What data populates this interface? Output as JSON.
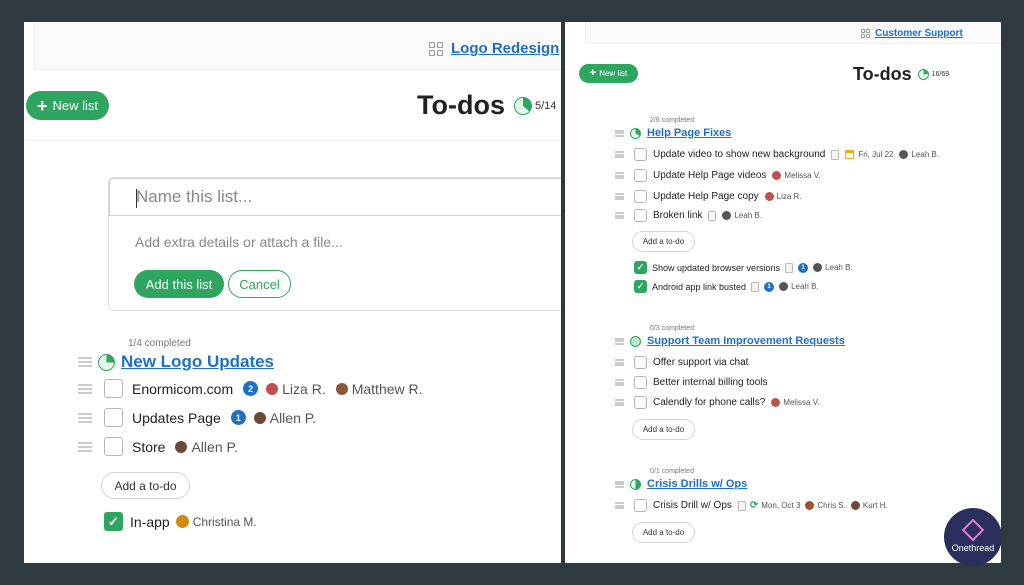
{
  "left": {
    "project_link": "Logo Redesign",
    "new_list_label": "New list",
    "title": "To-dos",
    "count": "5/14",
    "form": {
      "name_placeholder": "Name this list...",
      "details_placeholder": "Add extra details or attach a file...",
      "add_label": "Add this list",
      "cancel_label": "Cancel"
    },
    "list": {
      "meta": "1/4 completed",
      "title": "New Logo Updates",
      "todos": [
        {
          "text": "Enormicom.com",
          "badge": "2",
          "people": [
            "Liza R.",
            "Matthew R."
          ]
        },
        {
          "text": "Updates Page",
          "badge": "1",
          "people": [
            "Allen P."
          ]
        },
        {
          "text": "Store",
          "badge": "",
          "people": [
            "Allen P."
          ]
        }
      ],
      "add_todo_label": "Add a to-do",
      "completed": [
        {
          "text": "In-app",
          "people": [
            "Christina M."
          ]
        }
      ]
    }
  },
  "right": {
    "project_link": "Customer Support",
    "new_list_label": "New list",
    "title": "To-dos",
    "count": "16/69",
    "lists": [
      {
        "meta": "2/6 completed",
        "title": "Help Page Fixes",
        "todos": [
          {
            "text": "Update video to show new background",
            "date": "Fri, Jul 22",
            "people": [
              "Leah B."
            ]
          },
          {
            "text": "Update Help Page videos",
            "people": [
              "Melissa V."
            ]
          },
          {
            "text": "Update Help Page copy",
            "people": [
              "Liza R."
            ]
          },
          {
            "text": "Broken link",
            "people": [
              "Leah B."
            ]
          }
        ],
        "add_todo_label": "Add a to-do",
        "completed": [
          {
            "text": "Show updated browser versions",
            "badge": "1",
            "people": [
              "Leah B."
            ]
          },
          {
            "text": "Android app link busted",
            "badge": "1",
            "people": [
              "Leah B."
            ]
          }
        ]
      },
      {
        "meta": "0/3 completed",
        "title": "Support Team Improvement Requests",
        "todos": [
          {
            "text": "Offer support via chat"
          },
          {
            "text": "Better internal billing tools"
          },
          {
            "text": "Calendly for phone calls?",
            "people": [
              "Melissa V."
            ]
          }
        ],
        "add_todo_label": "Add a to-do"
      },
      {
        "meta": "0/1 completed",
        "title": "Crisis Drills w/ Ops",
        "todos": [
          {
            "text": "Crisis Drill w/ Ops",
            "date": "Mon, Oct 3",
            "people": [
              "Chris S.",
              "Kurt H."
            ]
          }
        ],
        "add_todo_label": "Add a to-do"
      }
    ]
  },
  "logo": {
    "name": "Onethread"
  },
  "colors": {
    "accent": "#2ea660",
    "link": "#1f6fc4",
    "background": "#2e3a40"
  }
}
